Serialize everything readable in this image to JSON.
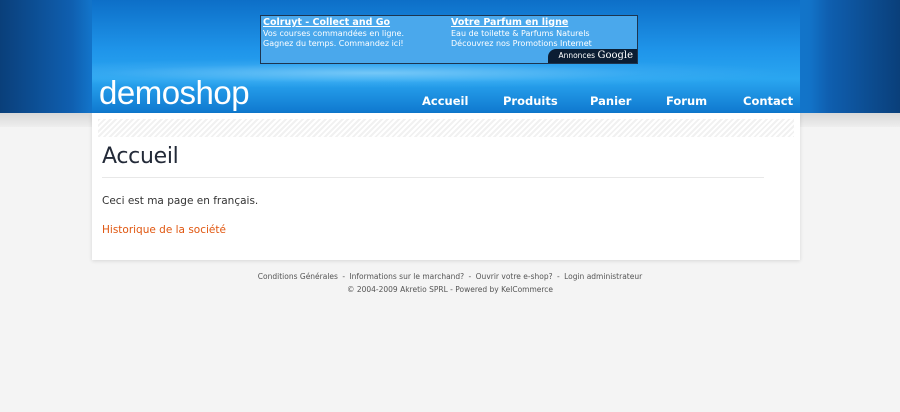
{
  "ad": {
    "col1": {
      "title": "Colruyt - Collect and Go",
      "line1": "Vos courses commandées en ligne.",
      "line2": "Gagnez du temps. Commandez ici!"
    },
    "col2": {
      "title": "Votre Parfum en ligne",
      "line1": "Eau de toilette & Parfums Naturels",
      "line2": "Découvrez nos Promotions Internet"
    },
    "badge_prefix": "Annonces",
    "badge_brand": "Google"
  },
  "logo": {
    "text": "demoshop"
  },
  "nav": {
    "items": [
      {
        "label": "Accueil"
      },
      {
        "label": "Produits"
      },
      {
        "label": "Panier"
      },
      {
        "label": "Forum"
      },
      {
        "label": "Contact"
      }
    ]
  },
  "content": {
    "title": "Accueil",
    "text": "Ceci est ma page en français.",
    "link": "Historique de la société"
  },
  "footer": {
    "links": [
      "Conditions Générales",
      "Informations sur le marchand?",
      "Ouvrir votre e-shop?",
      "Login administrateur"
    ],
    "sep1": " - ",
    "sep2": " - ",
    "sep3": " - ",
    "copyright": "© 2004-2009 Akretio SPRL - Powered by KelCommerce"
  },
  "colors": {
    "header_blue": "#1a8ee0",
    "link_orange": "#e0560f",
    "title_dark": "#232a38"
  }
}
